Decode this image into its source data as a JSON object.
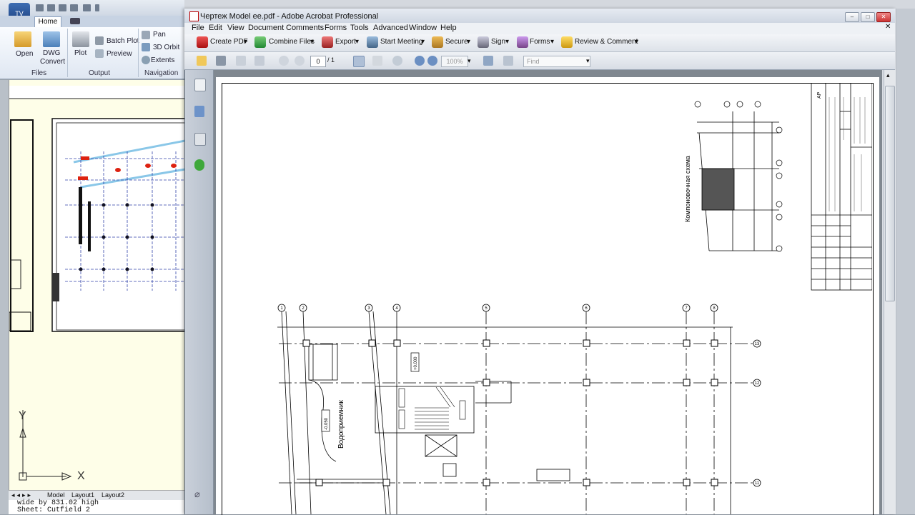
{
  "dwg": {
    "logo_text": "TV",
    "tabs": {
      "home": "Home"
    },
    "ribbon": {
      "open": "Open",
      "dwg_convert_1": "DWG",
      "dwg_convert_2": "Convert",
      "plot": "Plot",
      "batch_plot": "Batch Plot",
      "preview": "Preview",
      "pan": "Pan",
      "orbit": "3D Orbit",
      "extents": "Extents",
      "group_files": "Files",
      "group_output": "Output",
      "group_navigation": "Navigation"
    },
    "layouts": [
      "Model",
      "Layout1",
      "Layout2"
    ],
    "axis_y": "Y",
    "axis_x": "X",
    "command_line": [
      "wide by 831.02 high",
      "Sheet: Cutfield 2"
    ]
  },
  "acrobat": {
    "title": "Чертеж Model ee.pdf - Adobe Acrobat Professional",
    "menu": [
      "File",
      "Edit",
      "View",
      "Document",
      "Comments",
      "Forms",
      "Tools",
      "Advanced",
      "Window",
      "Help"
    ],
    "toolbar": {
      "create_pdf": "Create PDF",
      "combine_files": "Combine Files",
      "export": "Export",
      "start_meeting": "Start Meeting",
      "secure": "Secure",
      "sign": "Sign",
      "forms": "Forms",
      "review_comment": "Review & Comment"
    },
    "page_current": "0",
    "page_total": "/ 1",
    "zoom": "100%",
    "find_placeholder": "Find"
  },
  "drawing": {
    "sheet_code": "AP",
    "scheme_label": "Компоновочная схема",
    "room_label": "Водоприемник",
    "grid_top": [
      "1",
      "2",
      "3",
      "4",
      "5",
      "6",
      "7",
      "8"
    ],
    "grid_right": [
      "11",
      "12",
      "13"
    ],
    "level_1": "+0.000",
    "level_2": "-0.050"
  },
  "colors": {
    "acrobat_title_bg": "#d9e0ea",
    "close_red": "#c33333",
    "dwg_canvas": "#fefee8"
  }
}
